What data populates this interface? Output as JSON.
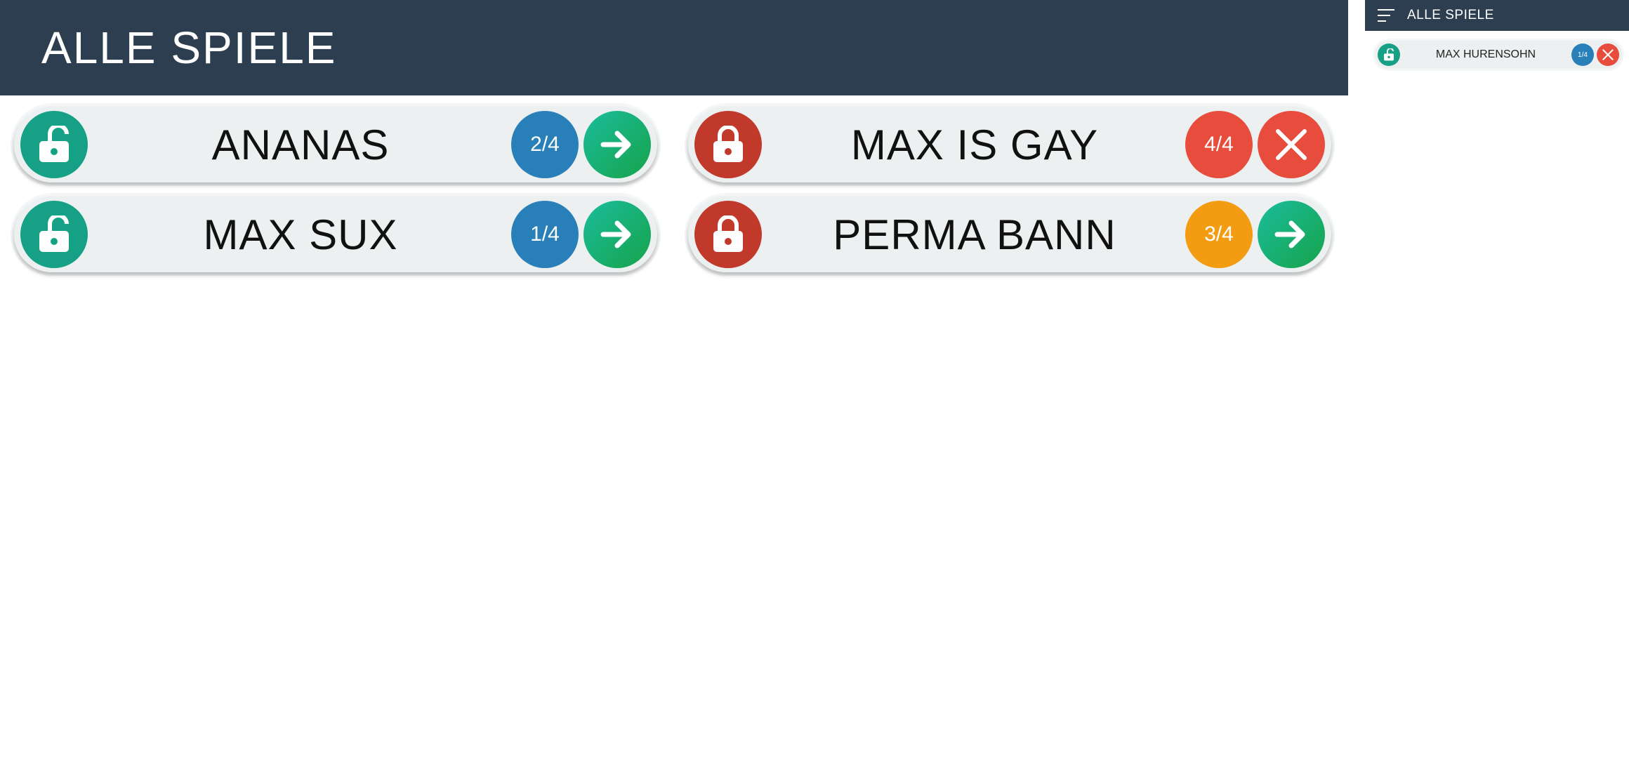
{
  "header": {
    "title": "ALLE SPIELE"
  },
  "games": [
    {
      "name": "ANANAS",
      "count": "2/4"
    },
    {
      "name": "MAX IS GAY",
      "count": "4/4"
    },
    {
      "name": "MAX SUX",
      "count": "1/4"
    },
    {
      "name": "PERMA BANN",
      "count": "3/4"
    }
  ],
  "side": {
    "title": "ALLE SPIELE",
    "game": {
      "name": "MAX HURENSOHN",
      "count": "1/4"
    }
  },
  "colors": {
    "header_bg": "#2c3e50",
    "unlocked": "#16a085",
    "locked": "#c0392b",
    "count_blue": "#2980b9",
    "count_red": "#e74c3c",
    "count_orange": "#f39c12",
    "go_green": "#1abc9c"
  },
  "icons": {
    "unlocked": "unlock-icon",
    "locked": "lock-icon",
    "join": "arrow-right-icon",
    "full": "close-icon",
    "menu": "menu-icon"
  }
}
